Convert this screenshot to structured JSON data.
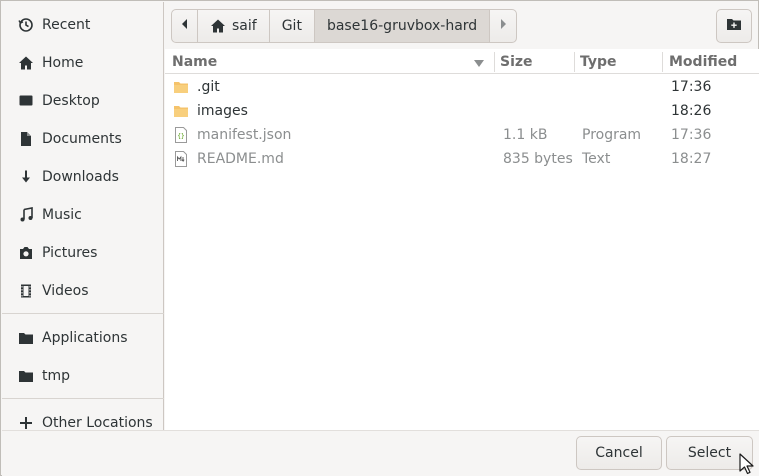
{
  "sidebar": {
    "items": [
      {
        "label": "Recent",
        "icon": "recent-icon"
      },
      {
        "label": "Home",
        "icon": "home-icon"
      },
      {
        "label": "Desktop",
        "icon": "desktop-icon"
      },
      {
        "label": "Documents",
        "icon": "documents-icon"
      },
      {
        "label": "Downloads",
        "icon": "downloads-icon"
      },
      {
        "label": "Music",
        "icon": "music-icon"
      },
      {
        "label": "Pictures",
        "icon": "pictures-icon"
      },
      {
        "label": "Videos",
        "icon": "videos-icon"
      },
      {
        "label": "Applications",
        "icon": "folder-icon"
      },
      {
        "label": "tmp",
        "icon": "folder-icon"
      },
      {
        "label": "Other Locations",
        "icon": "plus-icon"
      }
    ]
  },
  "pathbar": {
    "crumbs": [
      "saif",
      "Git",
      "base16-gruvbox-hard"
    ]
  },
  "filelist": {
    "columns": {
      "name": "Name",
      "size": "Size",
      "type": "Type",
      "modified": "Modified"
    },
    "rows": [
      {
        "name": ".git",
        "size": "",
        "type": "",
        "modified": "17:36",
        "kind": "folder"
      },
      {
        "name": "images",
        "size": "",
        "type": "",
        "modified": "18:26",
        "kind": "folder"
      },
      {
        "name": "manifest.json",
        "size": "1.1 kB",
        "type": "Program",
        "modified": "17:36",
        "kind": "json"
      },
      {
        "name": "README.md",
        "size": "835 bytes",
        "type": "Text",
        "modified": "18:27",
        "kind": "md"
      }
    ]
  },
  "buttons": {
    "cancel": "Cancel",
    "select": "Select"
  },
  "colors": {
    "folder": "#f5c36b",
    "active_crumb": "#dcd8d4",
    "dim_text": "#8b8e8f"
  }
}
